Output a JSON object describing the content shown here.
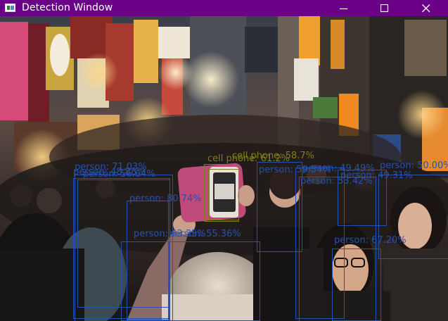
{
  "window": {
    "title": "Detection Window",
    "titlebar_color": "#6a0187",
    "buttons": {
      "minimize": "minimize-icon",
      "maximize": "maximize-icon",
      "close": "close-icon"
    }
  },
  "colors": {
    "person_box": "#2552b0",
    "phone_box": "#7e7e1c"
  },
  "detections": [
    {
      "label": "person: 71.03%",
      "class": "person"
    },
    {
      "label": "person: 48.88%",
      "class": "person"
    },
    {
      "label": "person: 56.64%",
      "class": "person"
    },
    {
      "label": "person: 59.54%",
      "class": "person"
    },
    {
      "label": "person: 80.74%",
      "class": "person"
    },
    {
      "label": "person: 53.42%",
      "class": "person"
    },
    {
      "label": "person: 49.31%",
      "class": "person"
    },
    {
      "label": "person: 50.00%",
      "class": "person"
    },
    {
      "label": "person: 63.35%",
      "class": "person"
    },
    {
      "label": "person: 55.36%",
      "class": "person"
    },
    {
      "label": "person: 49.49%",
      "class": "person"
    },
    {
      "label": "person: 67.20%",
      "class": "person"
    },
    {
      "label": "cell phone: 61.2%",
      "class": "phone"
    },
    {
      "label": "cell phone: 58.7%",
      "class": "phone"
    }
  ]
}
